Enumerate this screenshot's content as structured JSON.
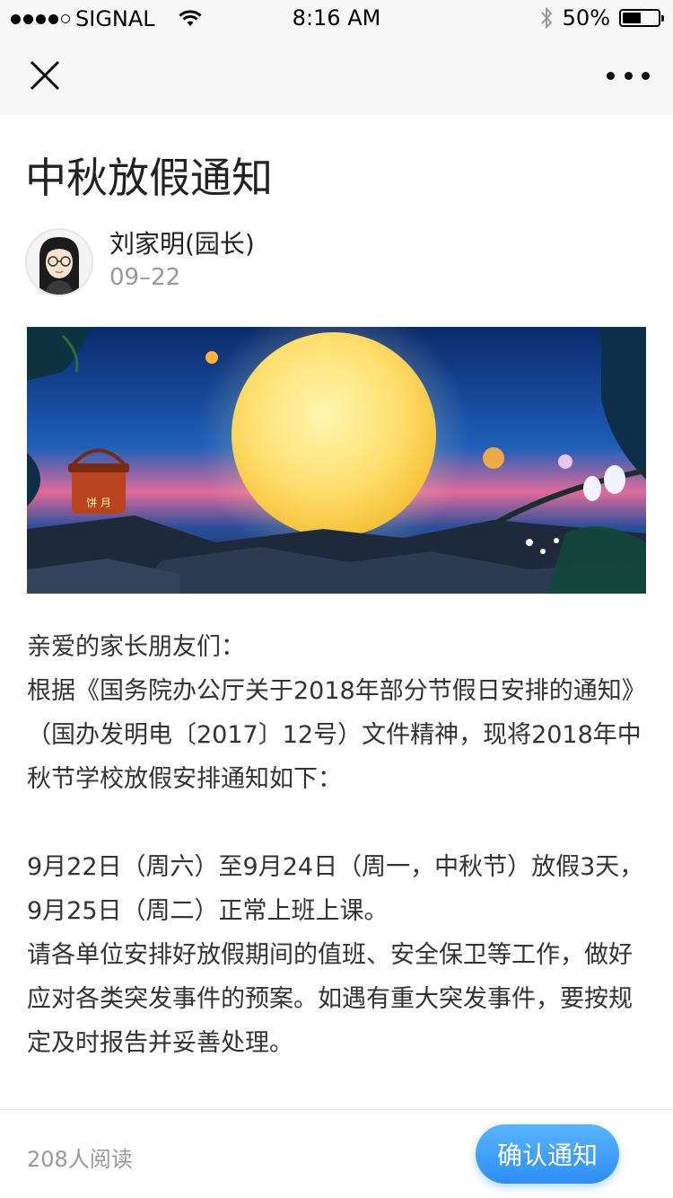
{
  "status_bar": {
    "carrier": "SIGNAL",
    "time": "8:16 AM",
    "battery": "50%",
    "battery_level": 0.5,
    "icons": [
      "signal-dots-icon",
      "wifi-icon",
      "bluetooth-icon",
      "battery-icon"
    ]
  },
  "nav": {
    "close_icon": "close-icon",
    "more_icon": "more-icon"
  },
  "article": {
    "title": "中秋放假通知",
    "author": "刘家明(园长)",
    "date": "09–22",
    "paragraphs": [
      "亲爱的家长朋友们：",
      "根据《国务院办公厅关于2018年部分节假日安排的通知》（国办发明电〔2017〕12号）文件精神，现将2018年中秋节学校放假安排通知如下：",
      "",
      "9月22日（周六）至9月24日（周一，中秋节）放假3天，9月25日（周二）正常上班上课。",
      "请各单位安排好放假期间的值班、安全保卫等工作，做好应对各类突发事件的预案。如遇有重大突发事件，要按规定及时报告并妥善处理。"
    ],
    "banner_caption": "饼 月"
  },
  "footer": {
    "reads": "208人阅读",
    "confirm_label": "确认通知"
  },
  "colors": {
    "accent": "#2c8ef2",
    "text": "#333333",
    "muted": "#999999"
  }
}
